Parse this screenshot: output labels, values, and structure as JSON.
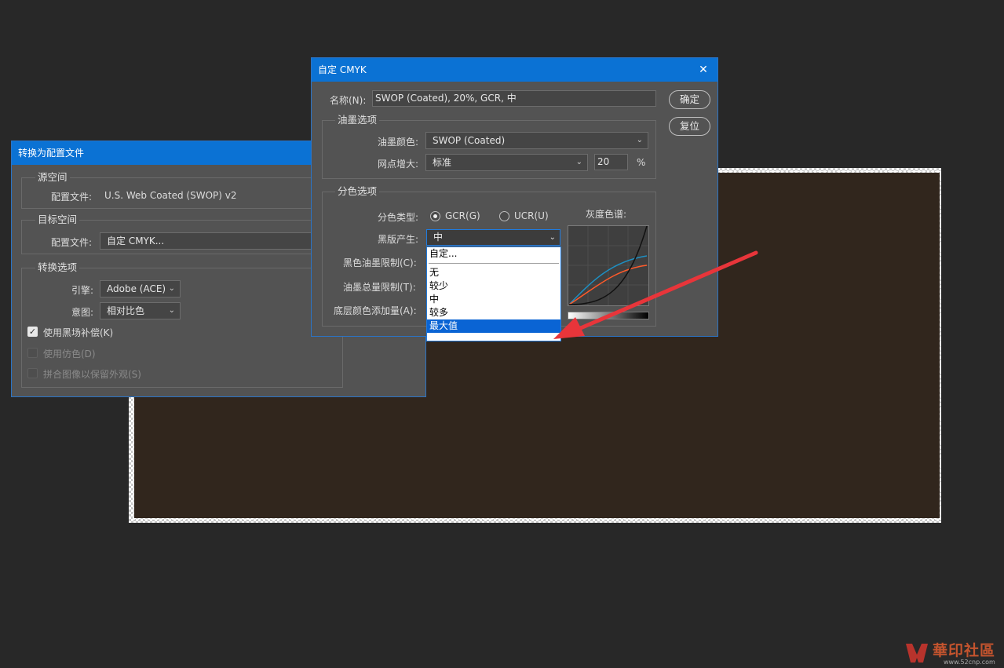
{
  "convert_dialog": {
    "title": "转换为配置文件",
    "source_space": {
      "group_title": "源空间",
      "profile_label": "配置文件:",
      "profile_value": "U.S. Web Coated (SWOP) v2"
    },
    "target_space": {
      "group_title": "目标空间",
      "profile_label": "配置文件:",
      "profile_value": "自定 CMYK..."
    },
    "conversion_options": {
      "group_title": "转换选项",
      "engine_label": "引擎:",
      "engine_value": "Adobe (ACE)",
      "intent_label": "意图:",
      "intent_value": "相对比色",
      "black_point_label": "使用黑场补偿(K)",
      "black_point_checked": true,
      "dither_label": "使用仿色(D)",
      "dither_checked": false,
      "flatten_label": "拼合图像以保留外观(S)",
      "flatten_checked": false
    }
  },
  "cmyk_dialog": {
    "title": "自定 CMYK",
    "name_label": "名称(N):",
    "name_value": "SWOP (Coated), 20%, GCR, 中",
    "ok_button": "确定",
    "reset_button": "复位",
    "ink_options": {
      "group_title": "油墨选项",
      "ink_colors_label": "油墨颜色:",
      "ink_colors_value": "SWOP (Coated)",
      "dot_gain_label": "网点增大:",
      "dot_gain_mode": "标准",
      "dot_gain_value": "20",
      "dot_gain_unit": "%"
    },
    "separation_options": {
      "group_title": "分色选项",
      "separation_type_label": "分色类型:",
      "gcr_label": "GCR(G)",
      "ucr_label": "UCR(U)",
      "selected_type": "GCR",
      "gray_ramp_label": "灰度色谱:",
      "black_generation_label": "黑版产生:",
      "black_generation_value": "中",
      "black_ink_limit_label": "黑色油墨限制(C):",
      "total_ink_limit_label": "油墨总量限制(T):",
      "ucr_amount_label": "底层颜色添加量(A):",
      "dropdown_options": [
        "自定...",
        "无",
        "较少",
        "中",
        "较多",
        "最大值"
      ],
      "highlighted_option": "最大值"
    }
  },
  "watermark": {
    "text": "華印社區",
    "url": "www.52cnp.com"
  },
  "colors": {
    "title_bar": "#0b72d4",
    "dialog_bg": "#535353",
    "document_fill": "#31261d",
    "arrow": "#e8353a",
    "curve_black": "#111111",
    "curve_cyan": "#1e8fc2",
    "curve_orange": "#ff5a2a"
  }
}
